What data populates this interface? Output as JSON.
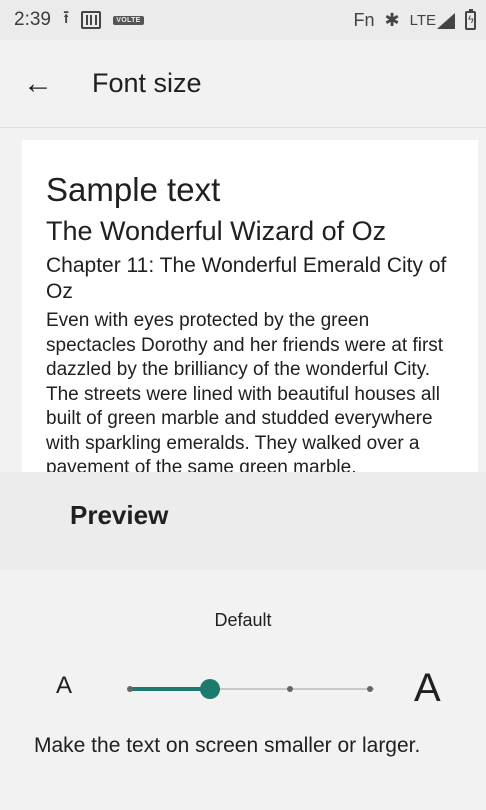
{
  "status_bar": {
    "time": "2:39",
    "volte_label": "VOLTE",
    "fn_label": "Fn",
    "network_label": "LTE",
    "icons": [
      "upload-icon",
      "sim-icon",
      "volte-icon",
      "bluetooth-icon",
      "signal-icon",
      "battery-charging-icon"
    ]
  },
  "app_bar": {
    "back_icon": "arrow-left-icon",
    "back_glyph": "←",
    "title": "Font size"
  },
  "preview": {
    "heading": "Sample text",
    "title": "The Wonderful Wizard of Oz",
    "chapter": "Chapter 11: The Wonderful Emerald City of Oz",
    "body": "Even with eyes protected by the green spectacles Dorothy and her friends were at first dazzled by the brilliancy of the wonderful City. The streets were lined with beautiful houses all built of green marble and studded everywhere with sparkling emeralds. They walked over a pavement of the same green marble.",
    "label": "Preview"
  },
  "controls": {
    "current_size_label": "Default",
    "small_label": "A",
    "large_label": "A",
    "slider_steps": 4,
    "slider_selected_index": 1,
    "description": "Make the text on screen smaller or larger.",
    "accent_color": "#1d7a6e"
  }
}
